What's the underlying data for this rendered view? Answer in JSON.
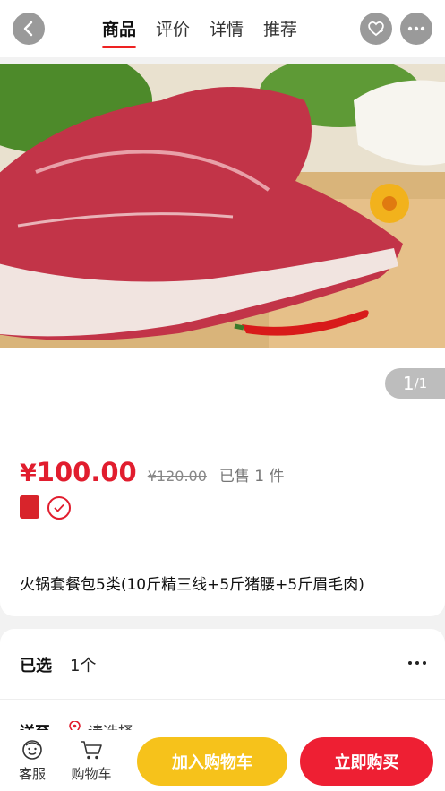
{
  "tabs": [
    {
      "label": "商品",
      "active": true
    },
    {
      "label": "评价",
      "active": false
    },
    {
      "label": "详情",
      "active": false
    },
    {
      "label": "推荐",
      "active": false
    }
  ],
  "header_icons": [
    "back-icon",
    "favorite-icon",
    "more-icon"
  ],
  "pager": {
    "current": "1",
    "total": "/1"
  },
  "product": {
    "price": "100.00",
    "currency": "¥",
    "original_price": "¥120.00",
    "sold": "已售 1 件",
    "title": "火锅套餐包5类(10斤精三线+5斤猪腰+5斤眉毛肉)"
  },
  "spec": {
    "label": "已选",
    "value": "1个"
  },
  "shipping": {
    "label": "送至",
    "value": "请选择"
  },
  "bottom": {
    "service_label": "客服",
    "cart_label": "购物车",
    "add_to_cart": "加入购物车",
    "buy_now": "立即购买"
  },
  "colors": {
    "accent": "#e11d2e",
    "add_to_cart_bg": "#f6c21b",
    "buy_bg": "#ee1f33"
  }
}
